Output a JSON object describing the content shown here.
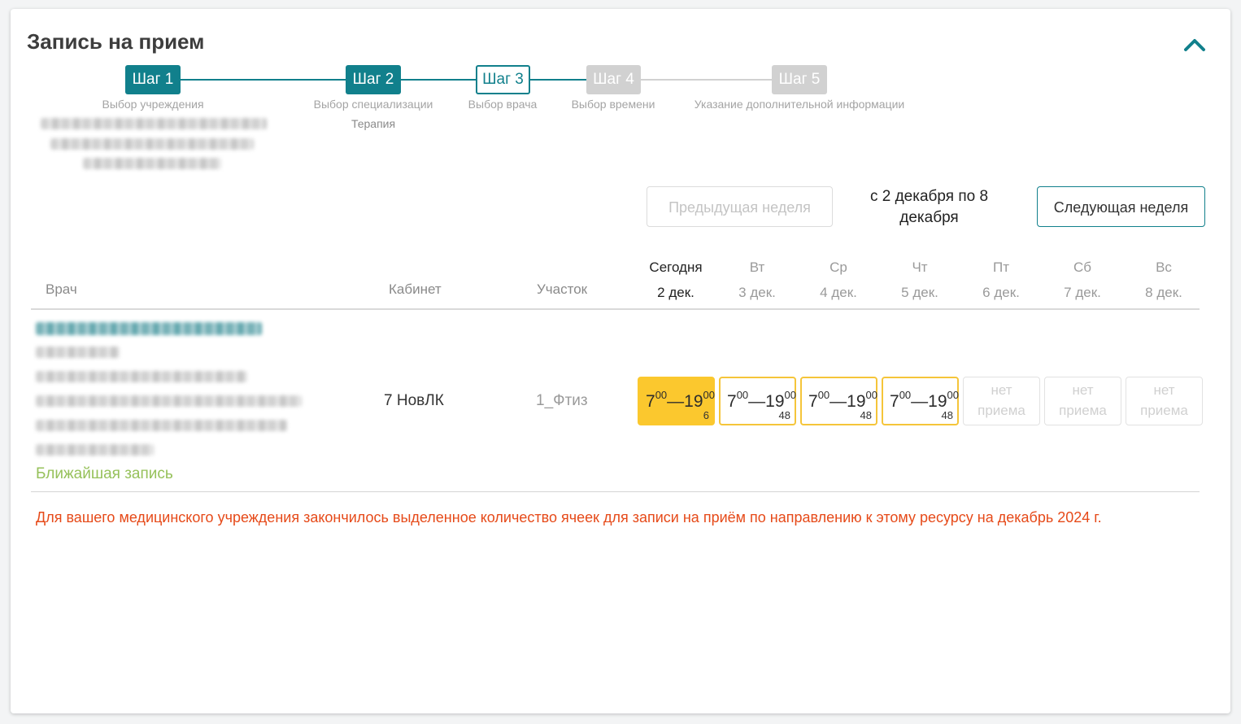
{
  "page": {
    "title": "Запись на прием"
  },
  "stepper": {
    "steps": [
      {
        "label": "Шаг 1",
        "caption": "Выбор учреждения",
        "state": "done"
      },
      {
        "label": "Шаг 2",
        "caption": "Выбор специализации",
        "value": "Терапия",
        "state": "done"
      },
      {
        "label": "Шаг 3",
        "caption": "Выбор врача",
        "state": "current"
      },
      {
        "label": "Шаг 4",
        "caption": "Выбор времени",
        "state": "future"
      },
      {
        "label": "Шаг 5",
        "caption": "Указание дополнительной информации",
        "state": "future"
      }
    ]
  },
  "week_nav": {
    "prev_label": "Предыдущая неделя",
    "range_label": "с 2 декабря по 8 декабря",
    "next_label": "Следующая неделя"
  },
  "table": {
    "headers": {
      "doctor": "Врач",
      "room": "Кабинет",
      "district": "Участок"
    },
    "days": [
      {
        "name": "Сегодня",
        "date": "2 дек.",
        "today": true
      },
      {
        "name": "Вт",
        "date": "3 дек."
      },
      {
        "name": "Ср",
        "date": "4 дек."
      },
      {
        "name": "Чт",
        "date": "5 дек."
      },
      {
        "name": "Пт",
        "date": "6 дек."
      },
      {
        "name": "Сб",
        "date": "7 дек."
      },
      {
        "name": "Вс",
        "date": "8 дек."
      }
    ],
    "row": {
      "room": "7 НовЛК",
      "district": "1_Фтиз",
      "nearest_label": "Ближайшая запись",
      "slots": [
        {
          "type": "today",
          "start_h": "7",
          "start_m": "00",
          "dash": "—",
          "end_h": "19",
          "end_m": "00",
          "count": "6"
        },
        {
          "type": "avail",
          "start_h": "7",
          "start_m": "00",
          "dash": "—",
          "end_h": "19",
          "end_m": "00",
          "count": "48"
        },
        {
          "type": "avail",
          "start_h": "7",
          "start_m": "00",
          "dash": "—",
          "end_h": "19",
          "end_m": "00",
          "count": "48"
        },
        {
          "type": "avail",
          "start_h": "7",
          "start_m": "00",
          "dash": "—",
          "end_h": "19",
          "end_m": "00",
          "count": "48"
        },
        {
          "type": "none",
          "text1": "нет",
          "text2": "приема"
        },
        {
          "type": "none",
          "text1": "нет",
          "text2": "приема"
        },
        {
          "type": "none",
          "text1": "нет",
          "text2": "приема"
        }
      ]
    }
  },
  "warning": "Для вашего медицинского учреждения закончилось выделенное количество ячеек для записи на приём по направлению к этому ресурсу на декабрь 2024 г.",
  "colors": {
    "accent": "#11808c",
    "slot_today": "#fbc82e",
    "slot_border": "#f5c53a",
    "nearest": "#96c15a",
    "warning": "#e64a19",
    "step_future": "#d1d1d1"
  },
  "icons": {
    "collapse": "chevron-up-icon"
  }
}
